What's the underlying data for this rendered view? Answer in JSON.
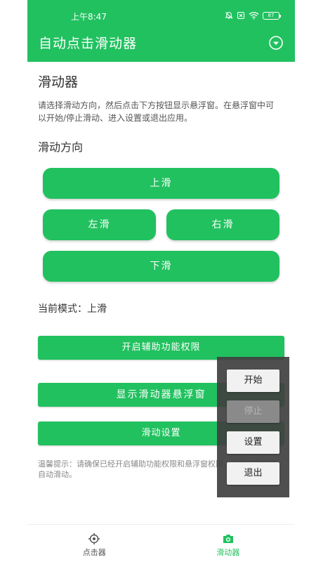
{
  "colors": {
    "accent": "#21c15f",
    "float_window_bg": "#404040",
    "float_button_bg": "#f1f1f1",
    "float_button_disabled_bg": "#8a8a8a",
    "nav_inactive": "#555555"
  },
  "status_bar": {
    "time": "上午8:47",
    "battery": "87",
    "icons": [
      "bell-off-icon",
      "sim-off-icon",
      "wifi-icon",
      "battery-icon"
    ]
  },
  "app_bar": {
    "title": "自动点击滑动器",
    "menu_icon": "chevron-down-circle-icon"
  },
  "main": {
    "section_title": "滑动器",
    "description": "请选择滑动方向，然后点击下方按钮显示悬浮窗。在悬浮窗中可以开始/停止滑动、进入设置或退出应用。",
    "direction_label": "滑动方向",
    "directions": {
      "up": "上滑",
      "left": "左滑",
      "right": "右滑",
      "down": "下滑"
    },
    "current_mode": "当前模式：上滑",
    "buttons": {
      "permission": "开启辅助功能权限",
      "show_floating": "显示滑动器悬浮窗",
      "settings": "滑动设置"
    },
    "tip": "温馨提示：请确保已经开启辅助功能权限和悬浮窗权限，才能正常使用自动滑动。"
  },
  "floating_window": {
    "start": "开始",
    "stop": "停止",
    "settings": "设置",
    "exit": "退出",
    "stop_enabled": false
  },
  "bottom_nav": {
    "items": [
      {
        "label": "点击器",
        "icon": "crosshair-icon",
        "active": false
      },
      {
        "label": "滑动器",
        "icon": "camera-icon",
        "active": true
      }
    ]
  }
}
